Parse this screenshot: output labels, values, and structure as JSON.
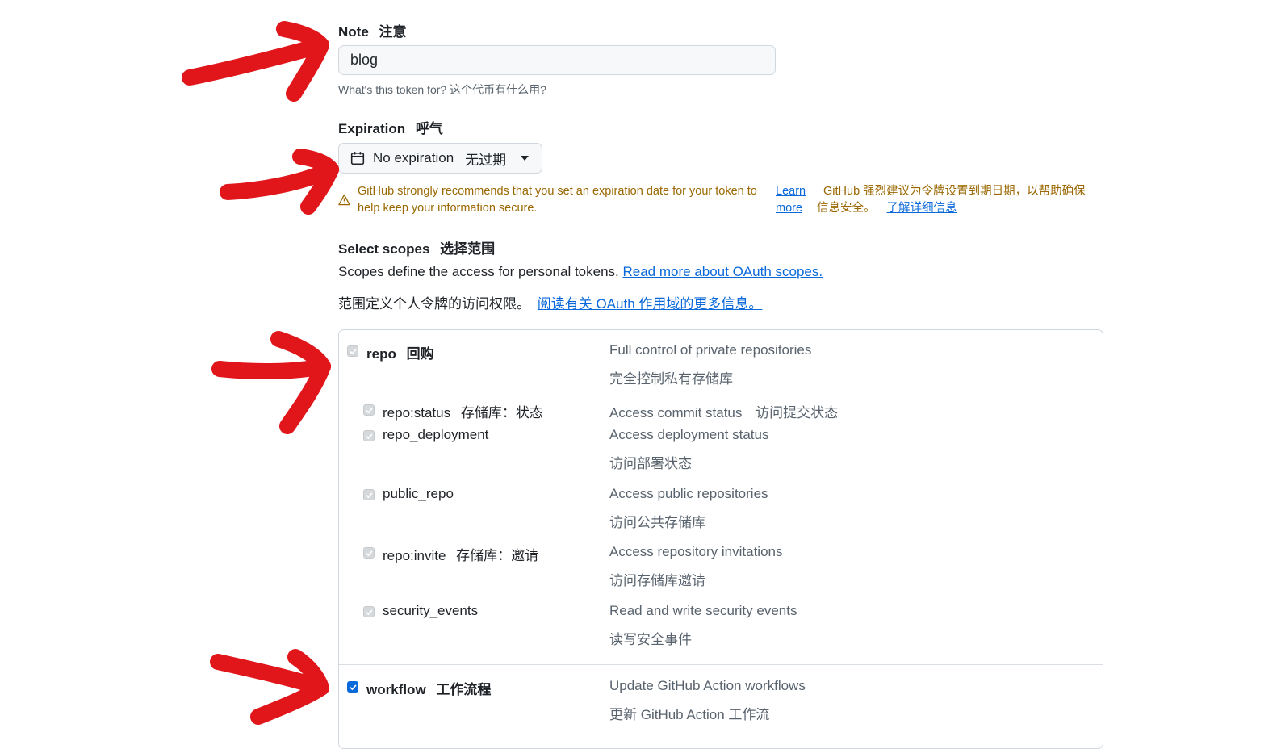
{
  "note": {
    "label": "Note",
    "label_cn": "注意",
    "value": "blog",
    "hint": "What's this token for?  这个代币有什么用?"
  },
  "expiration": {
    "label": "Expiration",
    "label_cn": "呼气",
    "selected": "No expiration",
    "selected_cn": "无过期",
    "warning_line1": "GitHub strongly recommends that you set an expiration date for your token to",
    "warning_line2": "help keep your information secure.",
    "learn": "Learn",
    "more": "more",
    "warning_cn_line1": "GitHub 强烈建议为令牌设置到期日期，以帮助确保",
    "warning_cn_line2": "信息安全。",
    "learn_more_cn": "了解详细信息"
  },
  "scopes_section": {
    "title": "Select scopes",
    "title_cn": "选择范围",
    "desc": "Scopes define the access for personal tokens.",
    "desc_link": "Read more about OAuth scopes.",
    "desc_cn": "范围定义个人令牌的访问权限。",
    "desc_link_cn": "阅读有关 OAuth 作用域的更多信息。"
  },
  "scopes": {
    "repo": {
      "name": "repo",
      "name_cn": "回购",
      "desc": "Full control of private repositories",
      "desc_cn": "完全控制私有存储库"
    },
    "repo_status": {
      "name": "repo:status",
      "name_cn": "存储库：状态",
      "desc": "Access commit status",
      "desc_cn": "访问提交状态"
    },
    "repo_deployment": {
      "name": "repo_deployment",
      "desc": "Access deployment status",
      "desc_cn": "访问部署状态"
    },
    "public_repo": {
      "name": "public_repo",
      "desc": "Access public repositories",
      "desc_cn": "访问公共存储库"
    },
    "repo_invite": {
      "name": "repo:invite",
      "name_cn": "存储库：邀请",
      "desc": "Access repository invitations",
      "desc_cn": "访问存储库邀请"
    },
    "security_events": {
      "name": "security_events",
      "desc": "Read and write security events",
      "desc_cn": "读写安全事件"
    },
    "workflow": {
      "name": "workflow",
      "name_cn": "工作流程",
      "desc": "Update GitHub Action workflows",
      "desc_cn": "更新 GitHub Action 工作流"
    }
  },
  "colors": {
    "accent": "#0969da",
    "warning": "#9a6700",
    "annotation_arrow": "#e0161b"
  },
  "icons": [
    "calendar-icon",
    "caret-down-icon",
    "alert-icon",
    "check-icon"
  ]
}
